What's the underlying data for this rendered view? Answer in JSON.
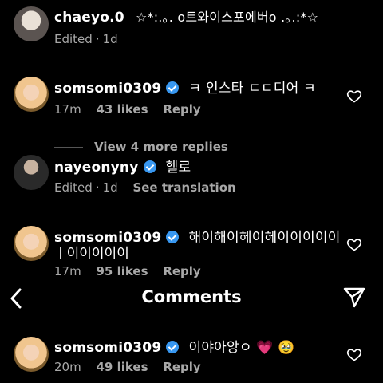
{
  "header": {
    "title": "Comments"
  },
  "comments": [
    {
      "username": "chaeyo.0",
      "verified": false,
      "text": "☆*:.｡. o트와이스포에버o .｡.:*☆",
      "meta": [
        "Edited",
        "1d"
      ]
    },
    {
      "username": "somsomi0309",
      "verified": true,
      "text": "ㅋ 인스타 ㄷㄷ디어 ㅋ",
      "time": "17m",
      "likes": "43 likes",
      "reply": "Reply",
      "view_more": "View 4 more replies"
    },
    {
      "username": "nayeonyny",
      "verified": true,
      "text": "헬로",
      "edited": "Edited",
      "time": "1d",
      "translate": "See translation"
    },
    {
      "username": "somsomi0309",
      "verified": true,
      "text_line1": "해이해이헤이헤이이이이이",
      "text_line2": "ㅣ이이이이이",
      "time": "17m",
      "likes": "95 likes",
      "reply": "Reply"
    },
    {
      "username": "somsomi0309",
      "verified": true,
      "text": "이야아앙ㅇ 💗 🥹",
      "time": "20m",
      "likes": "49 likes",
      "reply": "Reply"
    }
  ],
  "icons": {
    "back": "chevron-left-icon",
    "share": "send-icon",
    "heart": "heart-outline-icon"
  }
}
